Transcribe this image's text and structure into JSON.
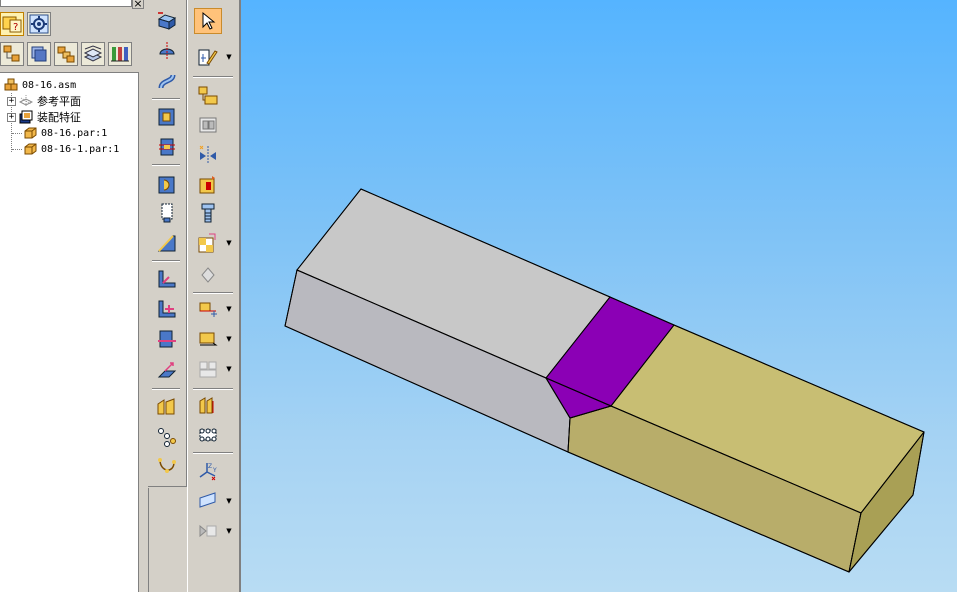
{
  "pane": {
    "close_glyph": "×"
  },
  "tree": {
    "items": [
      {
        "label": "08-16.asm",
        "icon": "assembly-icon",
        "expander": ""
      },
      {
        "label": "参考平面",
        "icon": "reference-plane-icon",
        "expander": "+"
      },
      {
        "label": "装配特征",
        "icon": "assembly-feature-icon",
        "expander": "+"
      },
      {
        "label": "08-16.par:1",
        "icon": "part-icon",
        "expander": ""
      },
      {
        "label": "08-16-1.par:1",
        "icon": "part-icon",
        "expander": ""
      }
    ]
  },
  "toolbar_left": {
    "buttons": [
      "extrude-protrusion-icon",
      "revolve-protrusion-icon",
      "sweep-protrusion-icon",
      "extrude-cutout-icon",
      "revolve-cutout-icon",
      "hole-icon",
      "thread-icon",
      "chamfer-icon",
      "rib-icon",
      "web-network-icon",
      "split-icon",
      "draft-icon",
      "thin-wall-icon",
      "pattern-icon",
      "curve-icon"
    ]
  },
  "toolbar_right": {
    "buttons": [
      "select-tool-icon",
      "sketch-icon",
      "place-part-icon",
      "replace-part-icon",
      "mirror-icon",
      "explode-icon",
      "fastener-icon",
      "assemble-icon",
      "relationship-icon",
      "move-part-icon",
      "motion-icon",
      "reposition-icon",
      "group-icon",
      "pattern-part-icon",
      "coordinate-system-icon",
      "plane-icon",
      "view-icon"
    ],
    "selected": "select-tool-icon"
  },
  "viewport": {
    "colors": {
      "part_1_top": "#c8c8c8",
      "part_1_front": "#b9b9bf",
      "part_2_top": "#c8be73",
      "part_2_front": "#b8ad6a",
      "part_2_end": "#a9a055",
      "highlight": "#8b00b5",
      "edges": "#000000"
    }
  }
}
